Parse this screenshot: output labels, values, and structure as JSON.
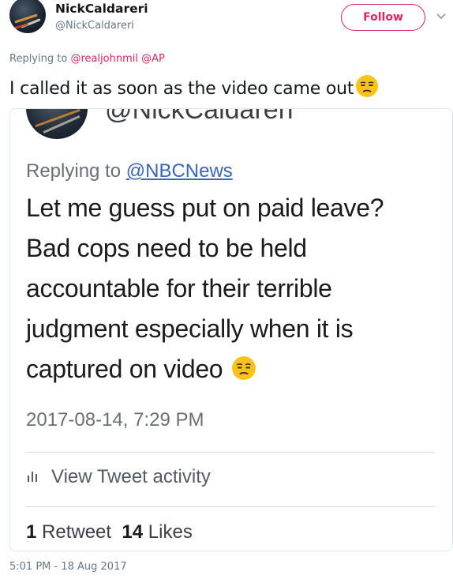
{
  "author": {
    "display_name": "NickCaldareri",
    "screen_name": "@NickCaldareri"
  },
  "follow_button": {
    "label": "Follow",
    "color": "#e0245e"
  },
  "caret_icon": "chevron-down-icon",
  "replying": {
    "prefix": "Replying to ",
    "mention1": "@realjohnmil",
    "mention2": "@AP"
  },
  "tweet": {
    "text": "I called it as soon as the video came out",
    "emoji": "unamused-face"
  },
  "quoted": {
    "handle": "@NickCaldareri",
    "replying_prefix": "Replying to ",
    "replying_mention": "@NBCNews",
    "lines": [
      "Let me guess put on paid leave?",
      "Bad cops need to be held",
      "accountable for their terrible",
      "judgment especially when it is",
      "captured on video"
    ],
    "date": "2017-08-14, 7:29 PM",
    "activity_label": "View Tweet activity",
    "retweets": "1",
    "retweets_label": " Retweet",
    "likes": "14",
    "likes_label": " Likes"
  },
  "timestamp": "5:01 PM - 18 Aug 2017"
}
